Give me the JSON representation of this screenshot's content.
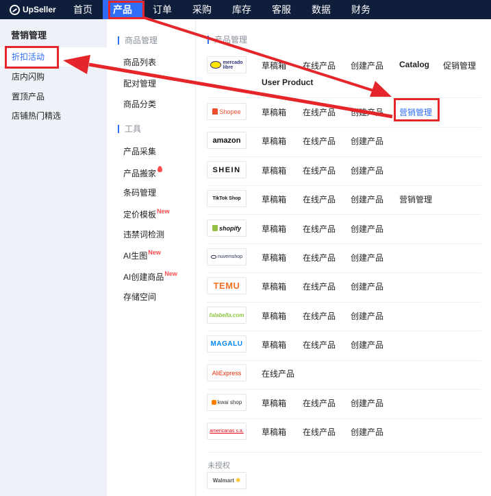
{
  "brand": {
    "name": "UpSeller"
  },
  "nav": [
    {
      "label": "首页",
      "active": false
    },
    {
      "label": "产品",
      "active": true
    },
    {
      "label": "订单",
      "active": false
    },
    {
      "label": "采购",
      "active": false
    },
    {
      "label": "库存",
      "active": false
    },
    {
      "label": "客服",
      "active": false
    },
    {
      "label": "数据",
      "active": false
    },
    {
      "label": "财务",
      "active": false
    }
  ],
  "sidebar": {
    "title": "营销管理",
    "items": [
      {
        "label": "折扣活动",
        "active": true
      },
      {
        "label": "店内闪购",
        "active": false
      },
      {
        "label": "置顶产品",
        "active": false
      },
      {
        "label": "店铺热门精选",
        "active": false
      }
    ]
  },
  "middle": {
    "group1": "商品管理",
    "group1_items": [
      "商品列表",
      "配对管理",
      "商品分类"
    ],
    "group2": "工具",
    "group2_items": [
      "产品采集",
      "产品搬家",
      "条码管理",
      "定价模板",
      "违禁词检测",
      "AI生图",
      "AI创建商品",
      "存储空间"
    ],
    "new_badge": "New"
  },
  "right": {
    "title": "产品管理",
    "platforms": [
      {
        "logo": "mercado libre",
        "logo_line1": "mercado",
        "logo_line2": "libre",
        "actions": [
          "草稿箱",
          "在线产品",
          "创建产品",
          "Catalog",
          "促销管理",
          "User Product"
        ]
      },
      {
        "logo": "Shopee",
        "actions": [
          "草稿箱",
          "在线产品",
          "创建产品",
          "营销管理"
        ]
      },
      {
        "logo": "amazon",
        "actions": [
          "草稿箱",
          "在线产品",
          "创建产品"
        ]
      },
      {
        "logo": "SHEIN",
        "actions": [
          "草稿箱",
          "在线产品",
          "创建产品"
        ]
      },
      {
        "logo": "TikTok Shop",
        "actions": [
          "草稿箱",
          "在线产品",
          "创建产品",
          "营销管理"
        ]
      },
      {
        "logo": "shopify",
        "actions": [
          "草稿箱",
          "在线产品",
          "创建产品"
        ]
      },
      {
        "logo": "nuvemshop",
        "actions": [
          "草稿箱",
          "在线产品",
          "创建产品"
        ]
      },
      {
        "logo": "TEMU",
        "actions": [
          "草稿箱",
          "在线产品",
          "创建产品"
        ]
      },
      {
        "logo": "falabella.com",
        "actions": [
          "草稿箱",
          "在线产品",
          "创建产品"
        ]
      },
      {
        "logo": "MAGALU",
        "actions": [
          "草稿箱",
          "在线产品",
          "创建产品"
        ]
      },
      {
        "logo": "AliExpress",
        "actions": [
          "在线产品"
        ]
      },
      {
        "logo": "kwai shop",
        "actions": [
          "草稿箱",
          "在线产品",
          "创建产品"
        ]
      },
      {
        "logo": "americanas s.a.",
        "actions": [
          "草稿箱",
          "在线产品",
          "创建产品"
        ]
      }
    ],
    "unauthorized_label": "未授权",
    "unauthorized_platforms": [
      {
        "logo": "Walmart"
      }
    ]
  },
  "colors": {
    "nav_bg": "#0f1e3a",
    "accent": "#2f6df6",
    "highlight": "#e4262b"
  }
}
